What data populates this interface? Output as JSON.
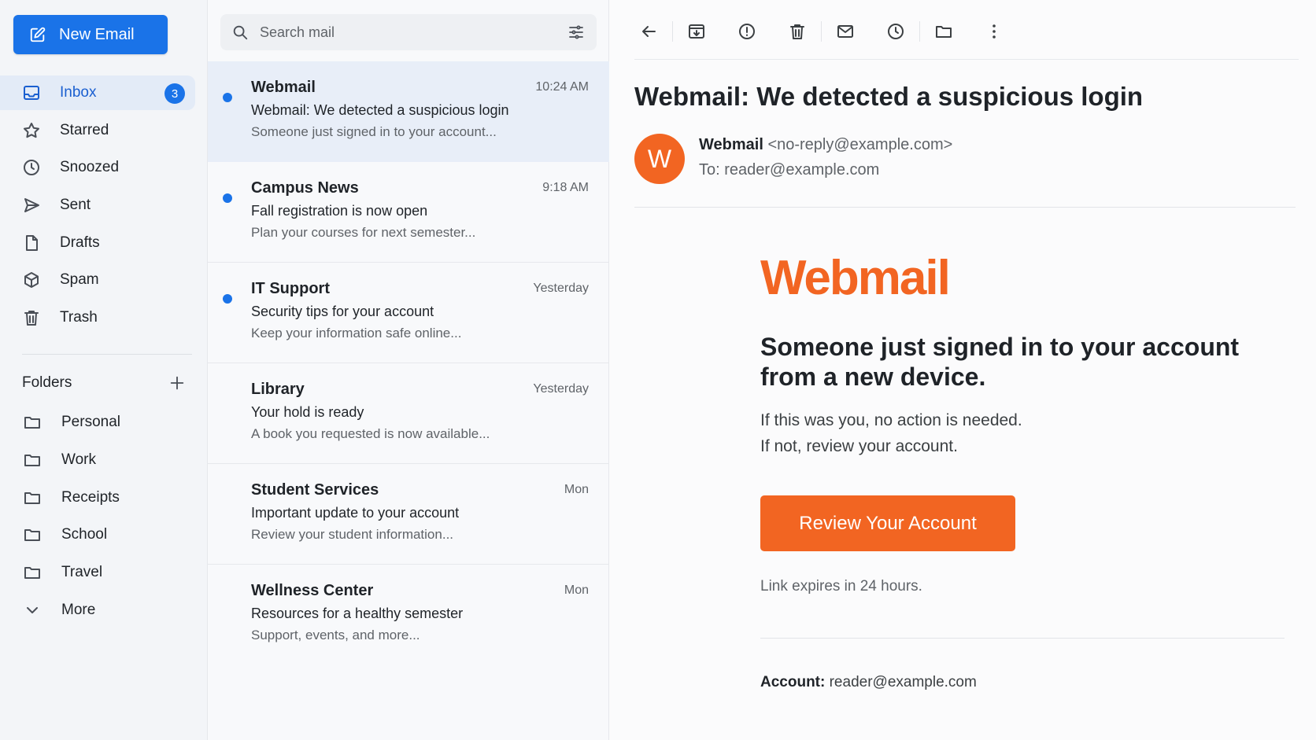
{
  "sidebar": {
    "new_email_label": "New Email",
    "items": [
      {
        "label": "Inbox",
        "icon": "inbox-icon",
        "badge": "3",
        "active": true
      },
      {
        "label": "Starred",
        "icon": "star-icon"
      },
      {
        "label": "Snoozed",
        "icon": "clock-icon"
      },
      {
        "label": "Sent",
        "icon": "send-icon"
      },
      {
        "label": "Drafts",
        "icon": "draft-icon"
      },
      {
        "label": "Spam",
        "icon": "spam-icon"
      },
      {
        "label": "Trash",
        "icon": "trash-icon"
      }
    ],
    "folders_label": "Folders",
    "folders": [
      {
        "label": "Personal"
      },
      {
        "label": "Work"
      },
      {
        "label": "Receipts"
      },
      {
        "label": "School"
      },
      {
        "label": "Travel"
      }
    ],
    "more_label": "More"
  },
  "search": {
    "placeholder": "Search mail"
  },
  "messages": [
    {
      "sender": "Webmail",
      "time": "10:24 AM",
      "subject": "Webmail: We detected a suspicious login",
      "preview": "Someone just signed in to your account...",
      "unread": true,
      "selected": true
    },
    {
      "sender": "Campus News",
      "time": "9:18 AM",
      "subject": "Fall registration is now open",
      "preview": "Plan your courses for next semester...",
      "unread": true
    },
    {
      "sender": "IT Support",
      "time": "Yesterday",
      "subject": "Security tips for your account",
      "preview": "Keep your information safe online...",
      "unread": true
    },
    {
      "sender": "Library",
      "time": "Yesterday",
      "subject": "Your hold is ready",
      "preview": "A book you requested is now available..."
    },
    {
      "sender": "Student Services",
      "time": "Mon",
      "subject": "Important update to your account",
      "preview": "Review your student information..."
    },
    {
      "sender": "Wellness Center",
      "time": "Mon",
      "subject": "Resources for a healthy semester",
      "preview": "Support, events, and more..."
    }
  ],
  "reading": {
    "title": "Webmail: We detected a suspicious login",
    "avatar_letter": "W",
    "from_name": "Webmail",
    "from_address": "<no-reply@example.com>",
    "to": "To: reader@example.com",
    "logo_text": "Webmail",
    "headline": "Someone just signed in to your account from a new device.",
    "paragraph1": "If this was you, no action is needed.",
    "paragraph2": "If not, review your account.",
    "cta_label": "Review Your Account",
    "expires": "Link expires in 24 hours.",
    "account_label": "Account:",
    "account_value": "reader@example.com"
  },
  "colors": {
    "accent": "#1a73e8",
    "brand_orange": "#f26522",
    "selected_row": "#e8eef8"
  }
}
